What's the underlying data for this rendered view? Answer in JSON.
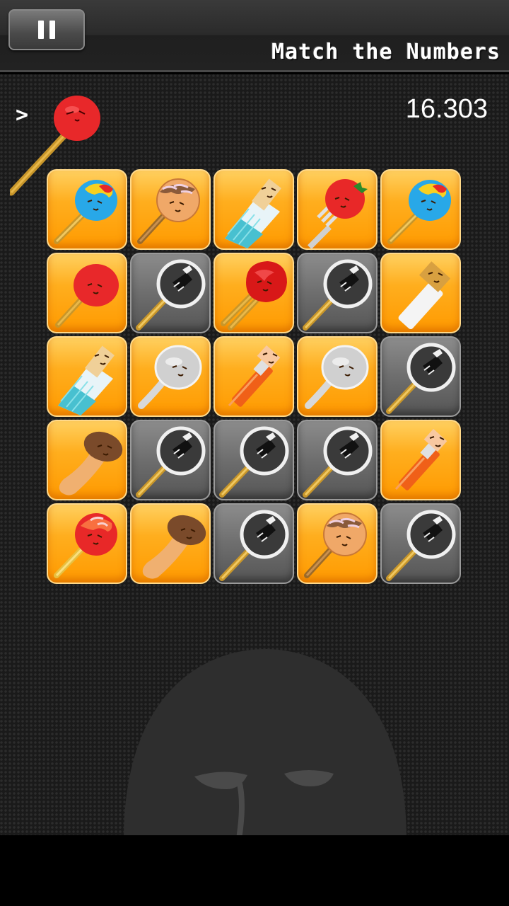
{
  "header": {
    "title": "Match the Numbers",
    "pause_icon": "pause-icon"
  },
  "hud": {
    "arrow": ">",
    "held_item": "red-ball-skewer",
    "timer": "16.303"
  },
  "board": {
    "rows": 5,
    "cols": 5,
    "tiles": [
      [
        "blue-candy",
        "takoyaki",
        "ice-pop",
        "tomato-fork",
        "blue-candy"
      ],
      [
        "red-ball",
        "mirror-empty",
        "red-lollipop",
        "mirror-empty",
        "white-stick"
      ],
      [
        "ice-pop",
        "silver-spoon",
        "orange-stick",
        "silver-spoon",
        "mirror-empty"
      ],
      [
        "mushroom",
        "mirror-empty",
        "mirror-empty",
        "mirror-empty",
        "orange-stick"
      ],
      [
        "red-candy",
        "mushroom",
        "mirror-empty",
        "takoyaki",
        "mirror-empty"
      ]
    ]
  },
  "colors": {
    "tile_orange": "#ff9a00",
    "tile_gray": "#6e6e6e",
    "background": "#1a1a1a"
  }
}
